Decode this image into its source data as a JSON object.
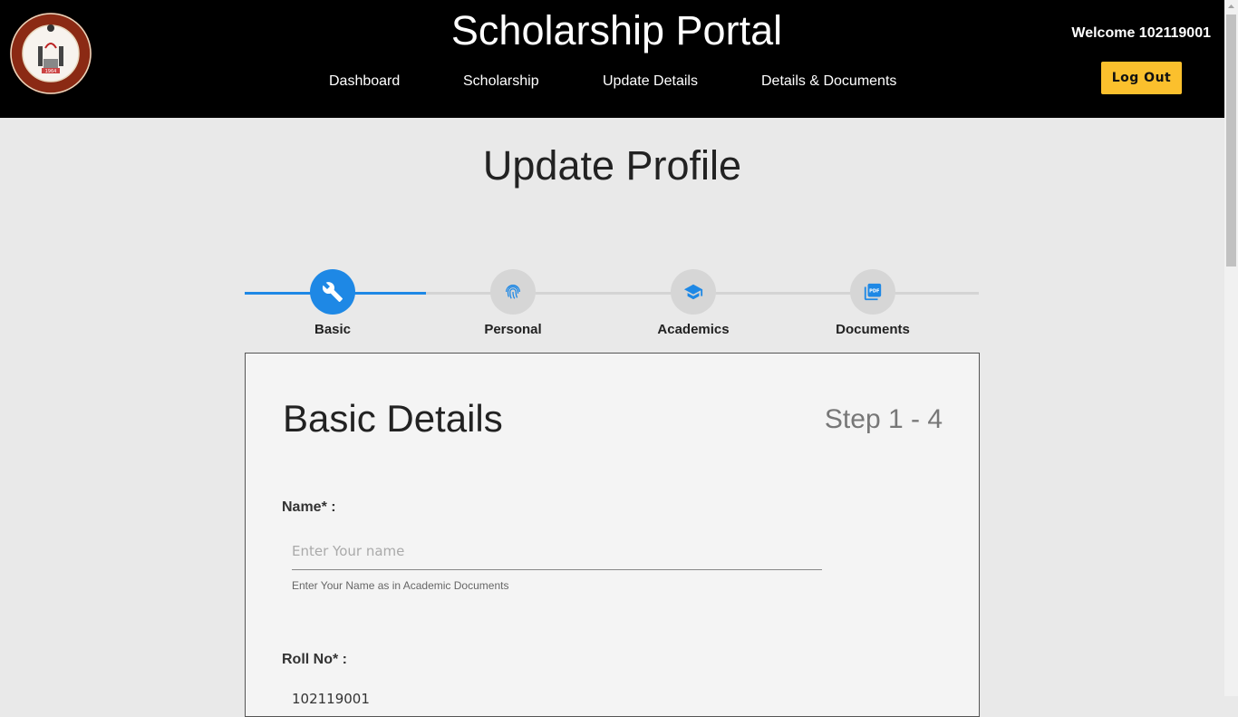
{
  "header": {
    "title": "Scholarship Portal",
    "nav": [
      "Dashboard",
      "Scholarship",
      "Update Details",
      "Details & Documents"
    ],
    "welcome": "Welcome 102119001",
    "logout_label": "Log Out",
    "logo_icon": "nit-trichy-logo"
  },
  "page": {
    "title": "Update Profile"
  },
  "stepper": {
    "active_color": "#1e88e5",
    "steps": [
      {
        "label": "Basic",
        "icon": "wrench-icon",
        "active": true
      },
      {
        "label": "Personal",
        "icon": "fingerprint-icon",
        "active": false
      },
      {
        "label": "Academics",
        "icon": "graduation-cap-icon",
        "active": false
      },
      {
        "label": "Documents",
        "icon": "pdf-icon",
        "active": false
      }
    ]
  },
  "form": {
    "title": "Basic Details",
    "step_indicator": "Step 1 - 4",
    "name_label": "Name* :",
    "name_placeholder": "Enter Your name",
    "name_value": "",
    "name_helper": "Enter Your Name as in Academic Documents",
    "roll_label": "Roll No* :",
    "roll_value": "102119001"
  },
  "colors": {
    "accent": "#1e88e5",
    "logout": "#fbc02d",
    "header_bg": "#000000"
  }
}
